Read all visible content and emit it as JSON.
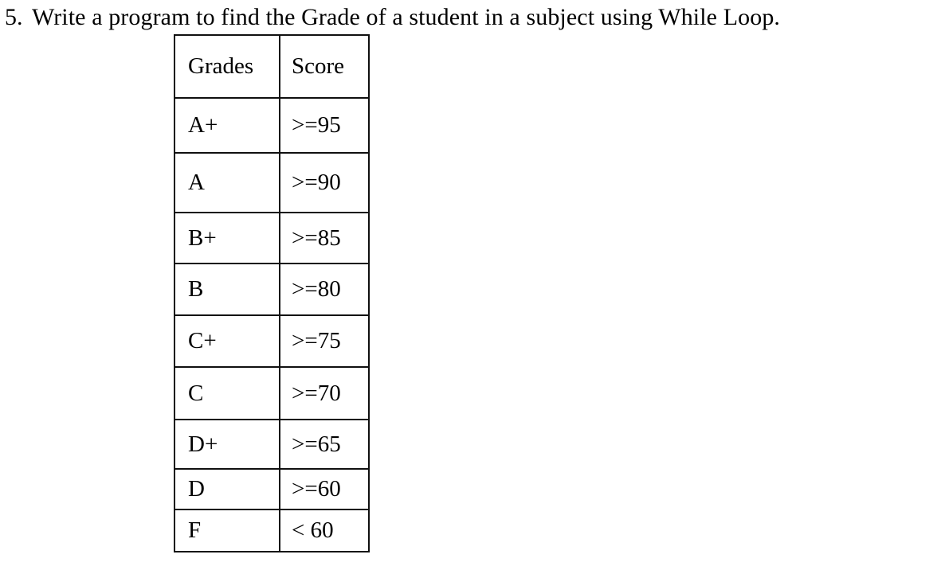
{
  "question": {
    "number": "5.",
    "text": "Write a program to find the Grade of a student in a subject using While Loop."
  },
  "grades_table": {
    "headers": {
      "grade": "Grades",
      "score": "Score"
    },
    "rows": [
      {
        "grade": "A+",
        "score": ">=95"
      },
      {
        "grade": "A",
        "score": ">=90"
      },
      {
        "grade": "B+",
        "score": ">=85"
      },
      {
        "grade": "B",
        "score": ">=80"
      },
      {
        "grade": "C+",
        "score": ">=75"
      },
      {
        "grade": "C",
        "score": ">=70"
      },
      {
        "grade": "D+",
        "score": ">=65"
      },
      {
        "grade": "D",
        "score": ">=60"
      },
      {
        "grade": "F",
        "score": "< 60"
      }
    ]
  },
  "colors": {
    "text": "#000000",
    "border": "#101010",
    "background": "#ffffff"
  }
}
